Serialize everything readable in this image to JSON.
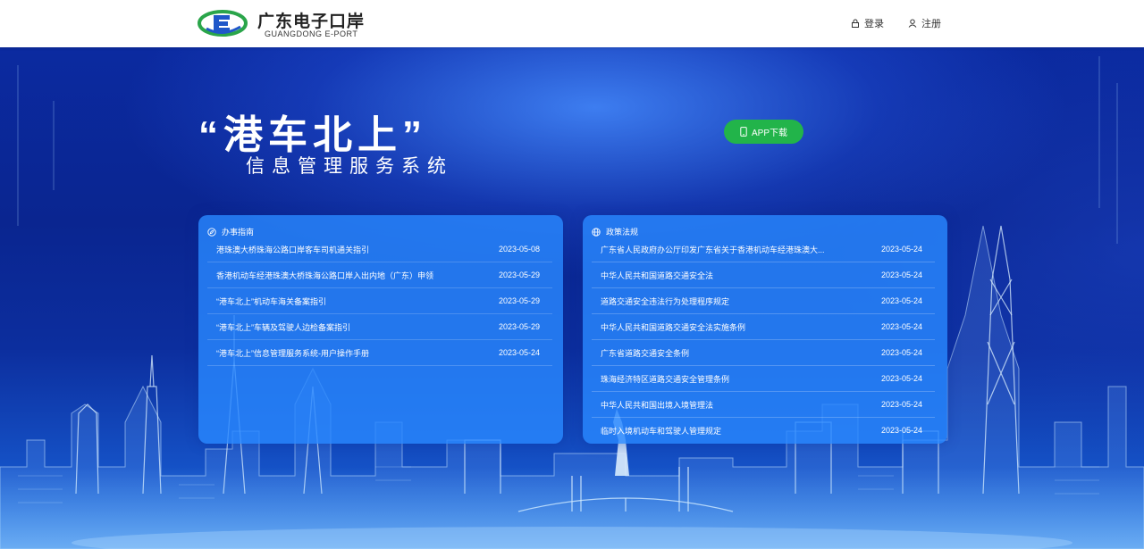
{
  "header": {
    "brand_cn": "广东电子口岸",
    "brand_en": "GUANGDONG E-PORT",
    "login_label": "登录",
    "register_label": "注册"
  },
  "hero": {
    "title": "“港车北上”",
    "subtitle": "信息管理服务系统",
    "app_button_label": "APP下载"
  },
  "guide": {
    "heading": "办事指南",
    "items": [
      {
        "title": "港珠澳大桥珠海公路口岸客车司机通关指引",
        "date": "2023-05-08"
      },
      {
        "title": "香港机动车经港珠澳大桥珠海公路口岸入出内地（广东）申领",
        "date": "2023-05-29"
      },
      {
        "title": "“港车北上”机动车海关备案指引",
        "date": "2023-05-29"
      },
      {
        "title": "“港车北上”车辆及驾驶人边检备案指引",
        "date": "2023-05-29"
      },
      {
        "title": "“港车北上”信息管理服务系统-用户操作手册",
        "date": "2023-05-24"
      }
    ]
  },
  "policy": {
    "heading": "政策法规",
    "items": [
      {
        "title": "广东省人民政府办公厅印发广东省关于香港机动车经港珠澳大...",
        "date": "2023-05-24"
      },
      {
        "title": "中华人民共和国道路交通安全法",
        "date": "2023-05-24"
      },
      {
        "title": "道路交通安全违法行为处理程序规定",
        "date": "2023-05-24"
      },
      {
        "title": "中华人民共和国道路交通安全法实施条例",
        "date": "2023-05-24"
      },
      {
        "title": "广东省道路交通安全条例",
        "date": "2023-05-24"
      },
      {
        "title": "珠海经济特区道路交通安全管理条例",
        "date": "2023-05-24"
      },
      {
        "title": "中华人民共和国出境入境管理法",
        "date": "2023-05-24"
      },
      {
        "title": "临时入境机动车和驾驶人管理规定",
        "date": "2023-05-24"
      }
    ]
  },
  "colors": {
    "brand_green": "#2aa54a",
    "brand_blue": "#1f57c9",
    "app_button": "#22b44a",
    "panel": "#2887ff"
  },
  "icons": {
    "login": "lock-icon",
    "register": "user-icon",
    "app": "phone-icon",
    "guide": "compass-icon",
    "policy": "globe-icon"
  }
}
